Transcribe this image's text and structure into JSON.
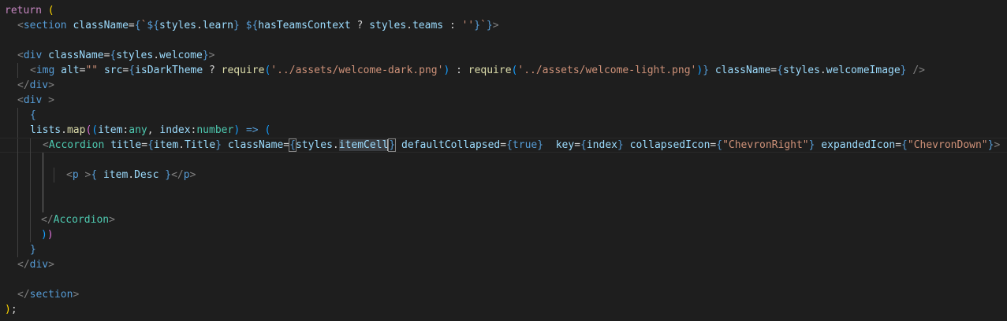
{
  "editor": {
    "theme_background": "#1e1e1e",
    "lines": [
      {
        "id": "l1",
        "tokens": [
          [
            "return",
            "kw"
          ],
          [
            " ",
            "plain"
          ],
          [
            "(",
            "b1"
          ]
        ]
      },
      {
        "id": "l2",
        "tokens": [
          [
            "<",
            "punc"
          ],
          [
            "section",
            "tag"
          ],
          [
            " ",
            "plain"
          ],
          [
            "className",
            "attr"
          ],
          [
            "=",
            "plain"
          ],
          [
            "{",
            "tag"
          ],
          [
            "`",
            "str"
          ],
          [
            "${",
            "tag"
          ],
          [
            "styles",
            "attr"
          ],
          [
            ".",
            "plain"
          ],
          [
            "learn",
            "attr"
          ],
          [
            "}",
            "tag"
          ],
          [
            " ",
            "str"
          ],
          [
            "${",
            "tag"
          ],
          [
            "hasTeamsContext",
            "attr"
          ],
          [
            " ? ",
            "plain"
          ],
          [
            "styles",
            "attr"
          ],
          [
            ".",
            "plain"
          ],
          [
            "teams",
            "attr"
          ],
          [
            " : ",
            "plain"
          ],
          [
            "''",
            "str"
          ],
          [
            "}",
            "tag"
          ],
          [
            "`",
            "str"
          ],
          [
            "}",
            "tag"
          ],
          [
            ">",
            "punc"
          ]
        ]
      },
      {
        "id": "l3",
        "tokens": []
      },
      {
        "id": "l4",
        "tokens": [
          [
            "<",
            "punc"
          ],
          [
            "div",
            "tag"
          ],
          [
            " ",
            "plain"
          ],
          [
            "className",
            "attr"
          ],
          [
            "=",
            "plain"
          ],
          [
            "{",
            "tag"
          ],
          [
            "styles",
            "attr"
          ],
          [
            ".",
            "plain"
          ],
          [
            "welcome",
            "attr"
          ],
          [
            "}",
            "tag"
          ],
          [
            ">",
            "punc"
          ]
        ]
      },
      {
        "id": "l5",
        "tokens": [
          [
            "<",
            "punc"
          ],
          [
            "img",
            "tag"
          ],
          [
            " ",
            "plain"
          ],
          [
            "alt",
            "attr"
          ],
          [
            "=",
            "plain"
          ],
          [
            "\"\"",
            "str"
          ],
          [
            " ",
            "plain"
          ],
          [
            "src",
            "attr"
          ],
          [
            "=",
            "plain"
          ],
          [
            "{",
            "tag"
          ],
          [
            "isDarkTheme",
            "attr"
          ],
          [
            " ? ",
            "plain"
          ],
          [
            "require",
            "fn"
          ],
          [
            "(",
            "b3"
          ],
          [
            "'../assets/welcome-dark.png'",
            "str"
          ],
          [
            ")",
            "b3"
          ],
          [
            " : ",
            "plain"
          ],
          [
            "require",
            "fn"
          ],
          [
            "(",
            "b3"
          ],
          [
            "'../assets/welcome-light.png'",
            "str"
          ],
          [
            ")",
            "b3"
          ],
          [
            "}",
            "tag"
          ],
          [
            " ",
            "plain"
          ],
          [
            "className",
            "attr"
          ],
          [
            "=",
            "plain"
          ],
          [
            "{",
            "tag"
          ],
          [
            "styles",
            "attr"
          ],
          [
            ".",
            "plain"
          ],
          [
            "welcomeImage",
            "attr"
          ],
          [
            "}",
            "tag"
          ],
          [
            " ",
            "plain"
          ],
          [
            "/>",
            "punc"
          ]
        ]
      },
      {
        "id": "l6",
        "tokens": [
          [
            "</",
            "punc"
          ],
          [
            "div",
            "tag"
          ],
          [
            ">",
            "punc"
          ]
        ]
      },
      {
        "id": "l7",
        "tokens": [
          [
            "<",
            "punc"
          ],
          [
            "div",
            "tag"
          ],
          [
            " ",
            "plain"
          ],
          [
            ">",
            "punc"
          ]
        ]
      },
      {
        "id": "l8",
        "tokens": [
          [
            "{",
            "tag"
          ]
        ]
      },
      {
        "id": "l9",
        "tokens": [
          [
            "lists",
            "attr"
          ],
          [
            ".",
            "plain"
          ],
          [
            "map",
            "fn"
          ],
          [
            "(",
            "b2"
          ],
          [
            "(",
            "b3"
          ],
          [
            "item",
            "attr"
          ],
          [
            ":",
            "plain"
          ],
          [
            "any",
            "type"
          ],
          [
            ", ",
            "plain"
          ],
          [
            "index",
            "attr"
          ],
          [
            ":",
            "plain"
          ],
          [
            "number",
            "type"
          ],
          [
            ")",
            "b3"
          ],
          [
            " => ",
            "tag"
          ],
          [
            "(",
            "b3"
          ]
        ]
      },
      {
        "id": "l10",
        "tokens": [
          [
            "<",
            "punc"
          ],
          [
            "Accordion",
            "comp"
          ],
          [
            " ",
            "plain"
          ],
          [
            "title",
            "attr"
          ],
          [
            "=",
            "plain"
          ],
          [
            "{",
            "tag"
          ],
          [
            "item",
            "attr"
          ],
          [
            ".",
            "plain"
          ],
          [
            "Title",
            "attr"
          ],
          [
            "}",
            "tag"
          ],
          [
            " ",
            "plain"
          ],
          [
            "className",
            "attr"
          ],
          [
            "=",
            "plain"
          ],
          [
            "{",
            "tag match"
          ],
          [
            "styles",
            "attr"
          ],
          [
            ".",
            "plain"
          ],
          [
            "itemCell",
            "attr sel"
          ],
          [
            "}",
            "tag match"
          ],
          [
            " ",
            "plain"
          ],
          [
            "defaultCollapsed",
            "attr"
          ],
          [
            "=",
            "plain"
          ],
          [
            "{",
            "tag"
          ],
          [
            "true",
            "tag"
          ],
          [
            "}",
            "tag"
          ],
          [
            "  ",
            "plain"
          ],
          [
            "key",
            "attr"
          ],
          [
            "=",
            "plain"
          ],
          [
            "{",
            "tag"
          ],
          [
            "index",
            "attr"
          ],
          [
            "}",
            "tag"
          ],
          [
            " ",
            "plain"
          ],
          [
            "collapsedIcon",
            "attr"
          ],
          [
            "=",
            "plain"
          ],
          [
            "{",
            "tag"
          ],
          [
            "\"ChevronRight\"",
            "str"
          ],
          [
            "}",
            "tag"
          ],
          [
            " ",
            "plain"
          ],
          [
            "expandedIcon",
            "attr"
          ],
          [
            "=",
            "plain"
          ],
          [
            "{",
            "tag"
          ],
          [
            "\"ChevronDown\"",
            "str"
          ],
          [
            "}",
            "tag"
          ],
          [
            ">",
            "punc"
          ]
        ]
      },
      {
        "id": "l11",
        "tokens": []
      },
      {
        "id": "l12",
        "tokens": [
          [
            "<",
            "punc"
          ],
          [
            "p",
            "tag"
          ],
          [
            " ",
            "plain"
          ],
          [
            ">",
            "punc"
          ],
          [
            "{",
            "tag"
          ],
          [
            " ",
            "plain"
          ],
          [
            "item",
            "attr"
          ],
          [
            ".",
            "plain"
          ],
          [
            "Desc",
            "attr"
          ],
          [
            " ",
            "plain"
          ],
          [
            "}",
            "tag"
          ],
          [
            "</",
            "punc"
          ],
          [
            "p",
            "tag"
          ],
          [
            ">",
            "punc"
          ]
        ]
      },
      {
        "id": "l13",
        "tokens": []
      },
      {
        "id": "l14",
        "tokens": []
      },
      {
        "id": "l15",
        "tokens": [
          [
            "</",
            "punc"
          ],
          [
            "Accordion",
            "comp"
          ],
          [
            ">",
            "punc"
          ]
        ]
      },
      {
        "id": "l16",
        "tokens": [
          [
            ")",
            "b3"
          ],
          [
            ")",
            "b2"
          ]
        ]
      },
      {
        "id": "l17",
        "tokens": [
          [
            "}",
            "tag"
          ]
        ]
      },
      {
        "id": "l18",
        "tokens": [
          [
            "</",
            "punc"
          ],
          [
            "div",
            "tag"
          ],
          [
            ">",
            "punc"
          ]
        ]
      },
      {
        "id": "l19",
        "tokens": []
      },
      {
        "id": "l20",
        "tokens": [
          [
            "</",
            "punc"
          ],
          [
            "section",
            "tag"
          ],
          [
            ">",
            "punc"
          ]
        ]
      },
      {
        "id": "l21",
        "tokens": [
          [
            ")",
            "b1"
          ],
          [
            ";",
            "plain"
          ]
        ]
      }
    ]
  }
}
